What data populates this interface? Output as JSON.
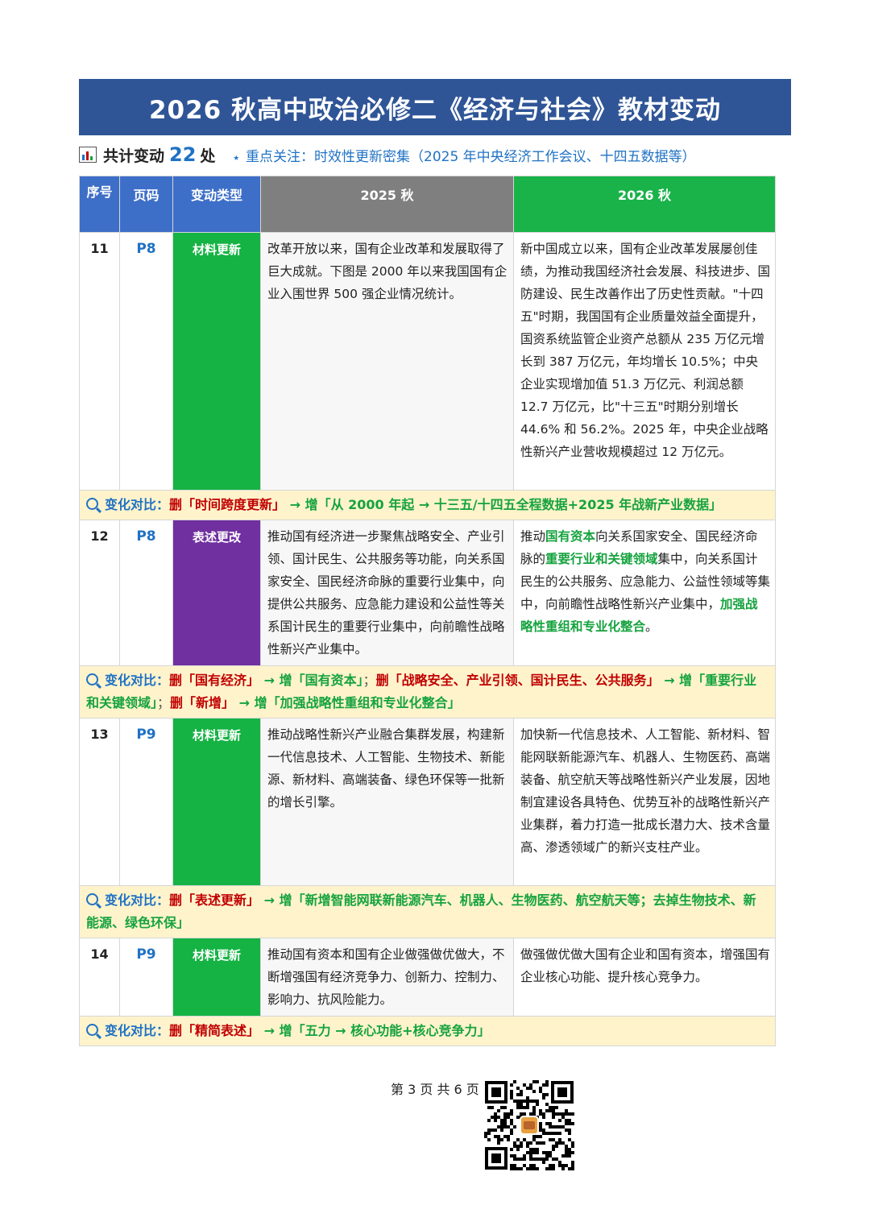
{
  "title": "2026 秋高中政治必修二《经济与社会》教材变动",
  "summary": {
    "label": "共计变动",
    "count": "22",
    "unit": "处",
    "focus": "重点关注：时效性更新密集（2025 年中央经济工作会议、十四五数据等）"
  },
  "headers": {
    "index": "序号",
    "page": "页码",
    "type": "变动类型",
    "old": "2025 秋",
    "new": "2026 秋"
  },
  "compare_label": "变化对比：",
  "rows": [
    {
      "num": "11",
      "page": "P8",
      "type": "材料更新",
      "old": "改革开放以来，国有企业改革和发展取得了巨大成就。下图是 2000 年以来我国国有企业入围世界 500 强企业情况统计。",
      "new": "新中国成立以来，国有企业改革发展屡创佳绩，为推动我国经济社会发展、科技进步、国防建设、民生改善作出了历史性贡献。\"十四五\"时期，我国国有企业质量效益全面提升，国资系统监管企业资产总额从 235 万亿元增长到 387 万亿元，年均增长 10.5%；中央企业实现增加值 51.3 万亿元、利润总额 12.7 万亿元，比\"十三五\"时期分别增长 44.6% 和 56.2%。2025 年，中央企业战略性新兴产业营收规模超过 12 万亿元。",
      "cmp_del1": "删「时间跨度更新」",
      "cmp_add1": "→ 增「从 2000 年起 → 十三五/十四五全程数据+2025 年战新产业数据」"
    },
    {
      "num": "12",
      "page": "P8",
      "type": "表述更改",
      "old": "推动国有经济进一步聚焦战略安全、产业引领、国计民生、公共服务等功能，向关系国家安全、国民经济命脉的重要行业集中，向提供公共服务、应急能力建设和公益性等关系国计民生的重要行业集中，向前瞻性战略性新兴产业集中。",
      "new_a": "推动",
      "new_h1": "国有资本",
      "new_b": "向关系国家安全、国民经济命脉的",
      "new_h2": "重要行业和关键领域",
      "new_c": "集中，向关系国计民生的公共服务、应急能力、公益性领域等集中，向前瞻性战略性新兴产业集中，",
      "new_h3": "加强战略性重组和专业化整合",
      "new_d": "。",
      "cmp_del1": "删「国有经济」",
      "cmp_add1": "→ 增「国有资本」",
      "cmp_del2": "删「战略安全、产业引领、国计民生、公共服务」",
      "cmp_add2": "→ 增「重要行业和关键领域」",
      "cmp_del3": "删「新增」",
      "cmp_add3": "→ 增「加强战略性重组和专业化整合」"
    },
    {
      "num": "13",
      "page": "P9",
      "type": "材料更新",
      "old": "推动战略性新兴产业融合集群发展，构建新一代信息技术、人工智能、生物技术、新能源、新材料、高端装备、绿色环保等一批新的增长引擎。",
      "new": "加快新一代信息技术、人工智能、新材料、智能网联新能源汽车、机器人、生物医药、高端装备、航空航天等战略性新兴产业发展，因地制宜建设各具特色、优势互补的战略性新兴产业集群，着力打造一批成长潜力大、技术含量高、渗透领域广的新兴支柱产业。",
      "cmp_del1": "删「表述更新」",
      "cmp_add1": "→ 增「新增智能网联新能源汽车、机器人、生物医药、航空航天等；去掉生物技术、新能源、绿色环保」"
    },
    {
      "num": "14",
      "page": "P9",
      "type": "材料更新",
      "old": "推动国有资本和国有企业做强做优做大，不断增强国有经济竞争力、创新力、控制力、影响力、抗风险能力。",
      "new": "做强做优做大国有企业和国有资本，增强国有企业核心功能、提升核心竞争力。",
      "cmp_del1": "删「精简表述」",
      "cmp_add1": "→ 增「五力 → 核心功能+核心竞争力」"
    }
  ],
  "separator": "；",
  "footer": "第 3 页 共 6 页",
  "colors": {
    "banner": "#2F5597",
    "header_blue": "#3E6FC8",
    "header_gray": "#7F7F7F",
    "header_green": "#19B34A",
    "type_material": "#15B344",
    "type_expression": "#7030A0",
    "compare_bg": "#FFF3CC",
    "delete": "#C00000",
    "add": "#15A33E",
    "accent": "#1F72C4"
  },
  "icons": [
    "bar-chart-icon",
    "star-icon",
    "magnifier-icon",
    "qr-code"
  ]
}
